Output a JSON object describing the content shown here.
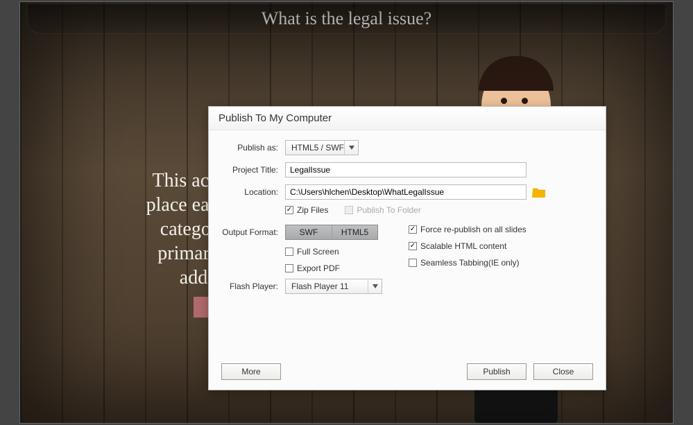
{
  "background": {
    "title": "What is the legal issue?",
    "prose": "This activi\nplace each c\ncategory\nprimary l\nadd"
  },
  "dialog": {
    "title": "Publish To My Computer",
    "labels": {
      "publish_as": "Publish as:",
      "project_title": "Project Title:",
      "location": "Location:",
      "output_format": "Output Format:",
      "flash_player": "Flash Player:"
    },
    "fields": {
      "publish_as_value": "HTML5 / SWF",
      "project_title_value": "LegalIssue",
      "location_value": "C:\\Users\\hlchen\\Desktop\\WhatLegalIssue",
      "flash_player_value": "Flash Player 11"
    },
    "output_format_options": {
      "swf": "SWF",
      "html5": "HTML5"
    },
    "checkboxes": {
      "zip_files": "Zip Files",
      "publish_to_folder": "Publish To Folder",
      "full_screen": "Full Screen",
      "export_pdf": "Export PDF",
      "force_republish": "Force re-publish on all slides",
      "scalable_html": "Scalable HTML content",
      "seamless_tabbing": "Seamless Tabbing(IE only)"
    },
    "checkbox_state": {
      "zip_files": true,
      "publish_to_folder": false,
      "publish_to_folder_disabled": true,
      "full_screen": false,
      "export_pdf": false,
      "force_republish": true,
      "scalable_html": true,
      "seamless_tabbing": false
    },
    "output_format_selected": [
      "swf",
      "html5"
    ],
    "buttons": {
      "more": "More",
      "publish": "Publish",
      "close": "Close"
    }
  }
}
